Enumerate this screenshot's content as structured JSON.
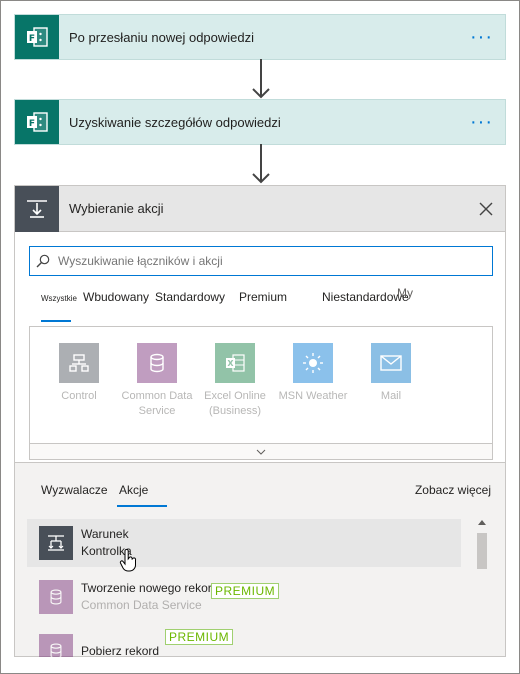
{
  "steps": [
    {
      "title": "Po przesłaniu nowej odpowiedzi",
      "more": "···",
      "icon": "forms-icon"
    },
    {
      "title": "Uzyskiwanie szczegółów odpowiedzi",
      "more": "···",
      "icon": "forms-icon"
    }
  ],
  "action": {
    "title": "Wybieranie akcji",
    "icon": "action-icon",
    "close": "×",
    "search_placeholder": "Wyszukiwanie łączników i akcji",
    "tabs": {
      "all": "Wszystkie",
      "builtin": "Wbudowany",
      "standard": "Standardowy",
      "premium": "Premium",
      "custom": "Niestandardowe",
      "my": "My"
    },
    "connectors": [
      {
        "label": "Control",
        "color": "#484f58"
      },
      {
        "label": "Common Data Service",
        "color": "#742774"
      },
      {
        "label": "Excel Online (Business)",
        "color": "#107c41"
      },
      {
        "label": "MSN Weather",
        "color": "#0078d4"
      },
      {
        "label": "Mail",
        "color": "#0072c6"
      }
    ],
    "lower_tabs": {
      "triggers": "Wyzwalacze",
      "actions": "Akcje",
      "see_more": "Zobacz więcej"
    },
    "items": [
      {
        "title": "Warunek",
        "subtitle": "Kontrolka",
        "info": "i"
      },
      {
        "title": "Tworzenie nowego rekordu",
        "subtitle": "Common Data Service",
        "badge": "PREMIUM",
        "info": "i"
      },
      {
        "title": "Pobierz rekord",
        "subtitle": "",
        "badge": "PREMIUM",
        "info": "i"
      }
    ]
  },
  "colors": {
    "accent": "#0078d4",
    "forms": "#077568",
    "control": "#484f58",
    "cds": "#742774",
    "premium": "#6bb700"
  }
}
